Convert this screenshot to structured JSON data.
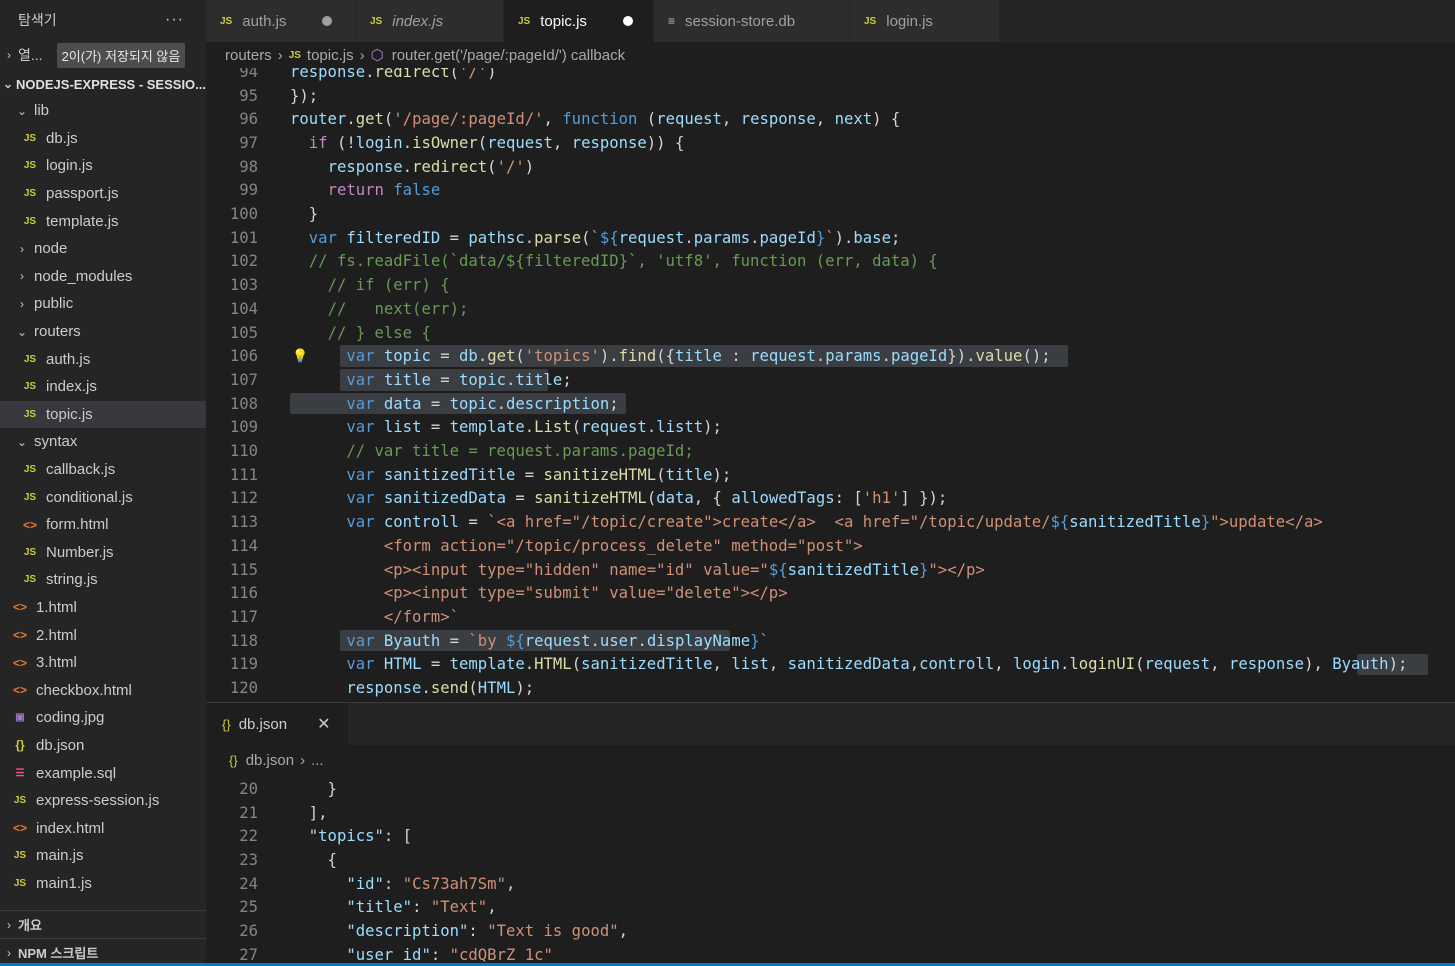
{
  "sidebar": {
    "title": "탐색기",
    "more": "···",
    "open_editors": {
      "label": "열...",
      "badge": "2이(가) 저장되지 않음"
    },
    "project": "NODEJS-EXPRESS - SESSIO...",
    "tree": [
      {
        "label": "lib",
        "type": "folder-open",
        "indent": 0
      },
      {
        "label": "db.js",
        "type": "js",
        "indent": 1
      },
      {
        "label": "login.js",
        "type": "js",
        "indent": 1
      },
      {
        "label": "passport.js",
        "type": "js",
        "indent": 1
      },
      {
        "label": "template.js",
        "type": "js",
        "indent": 1
      },
      {
        "label": "node",
        "type": "folder",
        "indent": 0
      },
      {
        "label": "node_modules",
        "type": "folder",
        "indent": 0
      },
      {
        "label": "public",
        "type": "folder",
        "indent": 0
      },
      {
        "label": "routers",
        "type": "folder-open",
        "indent": 0
      },
      {
        "label": "auth.js",
        "type": "js",
        "indent": 1
      },
      {
        "label": "index.js",
        "type": "js",
        "indent": 1
      },
      {
        "label": "topic.js",
        "type": "js",
        "indent": 1,
        "selected": true
      },
      {
        "label": "syntax",
        "type": "folder-open",
        "indent": 0
      },
      {
        "label": "callback.js",
        "type": "js",
        "indent": 1
      },
      {
        "label": "conditional.js",
        "type": "js",
        "indent": 1
      },
      {
        "label": "form.html",
        "type": "html",
        "indent": 1
      },
      {
        "label": "Number.js",
        "type": "js",
        "indent": 1
      },
      {
        "label": "string.js",
        "type": "js",
        "indent": 1
      },
      {
        "label": "1.html",
        "type": "html",
        "indent": 0
      },
      {
        "label": "2.html",
        "type": "html",
        "indent": 0
      },
      {
        "label": "3.html",
        "type": "html",
        "indent": 0
      },
      {
        "label": "checkbox.html",
        "type": "html",
        "indent": 0
      },
      {
        "label": "coding.jpg",
        "type": "img",
        "indent": 0
      },
      {
        "label": "db.json",
        "type": "json",
        "indent": 0
      },
      {
        "label": "example.sql",
        "type": "sql",
        "indent": 0
      },
      {
        "label": "express-session.js",
        "type": "js",
        "indent": 0
      },
      {
        "label": "index.html",
        "type": "html",
        "indent": 0
      },
      {
        "label": "main.js",
        "type": "js",
        "indent": 0
      },
      {
        "label": "main1.js",
        "type": "js",
        "indent": 0
      }
    ],
    "outline": "개요",
    "npm": "NPM 스크립트"
  },
  "tabs": [
    {
      "label": "auth.js",
      "icon": "js",
      "dirty": true,
      "italic": false,
      "active": false
    },
    {
      "label": "index.js",
      "icon": "js",
      "dirty": false,
      "italic": true,
      "active": false
    },
    {
      "label": "topic.js",
      "icon": "js",
      "dirty": true,
      "italic": false,
      "active": true
    },
    {
      "label": "session-store.db",
      "icon": "db",
      "dirty": false,
      "italic": false,
      "active": false
    },
    {
      "label": "login.js",
      "icon": "js",
      "dirty": false,
      "italic": false,
      "active": false
    }
  ],
  "breadcrumb": {
    "folder": "routers",
    "file": "topic.js",
    "symbol": "router.get('/page/:pageId/') callback"
  },
  "editor": {
    "lines": [
      {
        "n": "94",
        "html": "<span class='v'>response</span>.<span class='f'>redirect</span>(<span class='s'>'/'</span>)"
      },
      {
        "n": "95",
        "html": "});"
      },
      {
        "n": "96",
        "html": "<span class='v'>router</span>.<span class='f'>get</span>(<span class='s'>'/page/:pageId/'</span>, <span class='k'>function</span> (<span class='v'>request</span>, <span class='v'>response</span>, <span class='v'>next</span>) {"
      },
      {
        "n": "97",
        "html": "  <span class='kc'>if</span> (!<span class='v'>login</span>.<span class='f'>isOwner</span>(<span class='v'>request</span>, <span class='v'>response</span>)) {"
      },
      {
        "n": "98",
        "html": "    <span class='v'>response</span>.<span class='f'>redirect</span>(<span class='s'>'/'</span>)"
      },
      {
        "n": "99",
        "html": "    <span class='kc'>return</span> <span class='k'>false</span>"
      },
      {
        "n": "100",
        "html": "  }"
      },
      {
        "n": "101",
        "html": "  <span class='k'>var</span> <span class='v'>filteredID</span> = <span class='v'>pathsc</span>.<span class='f'>parse</span>(<span class='s'>`</span><span class='k'>${</span><span class='v'>request</span>.<span class='v'>params</span>.<span class='v'>pageId</span><span class='k'>}</span><span class='s'>`</span>).<span class='v'>base</span>;"
      },
      {
        "n": "102",
        "html": "  <span class='c'>// fs.readFile(`data/${filteredID}`, 'utf8', function (err, data) {</span>"
      },
      {
        "n": "103",
        "html": "    <span class='c'>// if (err) {</span>"
      },
      {
        "n": "104",
        "html": "    <span class='c'>//   next(err);</span>"
      },
      {
        "n": "105",
        "html": "    <span class='c'>// } else {</span>"
      },
      {
        "n": "106",
        "html": "      <span class='k'>var</span> <span class='v'>topic</span> = <span class='v'>db</span>.<span class='f'>get</span>(<span class='s'>'topics'</span>).<span class='f'>find</span>({<span class='v'>title</span> : <span class='v'>request</span>.<span class='v'>params</span>.<span class='v'>pageId</span>}).<span class='f'>value</span>();",
        "hl": [
          50,
          778
        ],
        "bulb": true
      },
      {
        "n": "107",
        "html": "      <span class='k'>var</span> <span class='v'>title</span> = <span class='v'>topic</span>.<span class='v'>title</span>;",
        "hl": [
          50,
          258
        ]
      },
      {
        "n": "108",
        "html": "      <span class='k'>var</span> <span class='v'>data</span> = <span class='v'>topic</span>.<span class='v'>description</span>;",
        "hl": [
          0,
          336
        ]
      },
      {
        "n": "109",
        "html": "      <span class='k'>var</span> <span class='v'>list</span> = <span class='v'>template</span>.<span class='f'>List</span>(<span class='v'>request</span>.<span class='v'>listt</span>);"
      },
      {
        "n": "110",
        "html": "      <span class='c'>// var title = request.params.pageId;</span>"
      },
      {
        "n": "111",
        "html": "      <span class='k'>var</span> <span class='v'>sanitizedTitle</span> = <span class='f'>sanitizeHTML</span>(<span class='v'>title</span>);"
      },
      {
        "n": "112",
        "html": "      <span class='k'>var</span> <span class='v'>sanitizedData</span> = <span class='f'>sanitizeHTML</span>(<span class='v'>data</span>, { <span class='v'>allowedTags</span>: [<span class='s'>'h1'</span>] });"
      },
      {
        "n": "113",
        "html": "      <span class='k'>var</span> <span class='v'>controll</span> = <span class='s'>`&lt;a href=\"/topic/create\"&gt;create&lt;/a&gt;  &lt;a href=\"/topic/update/</span><span class='k'>${</span><span class='v'>sanitizedTitle</span><span class='k'>}</span><span class='s'>\"&gt;update&lt;/a&gt;</span>"
      },
      {
        "n": "114",
        "html": "<span class='s'>          &lt;form action=\"/topic/process_delete\" method=\"post\"&gt;</span>"
      },
      {
        "n": "115",
        "html": "<span class='s'>          &lt;p&gt;&lt;input type=\"hidden\" name=\"id\" value=\"</span><span class='k'>${</span><span class='v'>sanitizedTitle</span><span class='k'>}</span><span class='s'>\"&gt;&lt;/p&gt;</span>"
      },
      {
        "n": "116",
        "html": "<span class='s'>          &lt;p&gt;&lt;input type=\"submit\" value=\"delete\"&gt;&lt;/p&gt;</span>"
      },
      {
        "n": "117",
        "html": "<span class='s'>          &lt;/form&gt;`</span>"
      },
      {
        "n": "118",
        "html": "      <span class='k'>var</span> <span class='v'>Byauth</span> = <span class='s'>`by </span><span class='k'>${</span><span class='v'>request</span>.<span class='v'>user</span>.<span class='v'>displayName</span><span class='k'>}</span><span class='s'>`</span>",
        "hl": [
          50,
          440
        ]
      },
      {
        "n": "119",
        "html": "      <span class='k'>var</span> <span class='v'>HTML</span> = <span class='v'>template</span>.<span class='f'>HTML</span>(<span class='v'>sanitizedTitle</span>, <span class='v'>list</span>, <span class='v'>sanitizedData</span>,<span class='v'>controll</span>, <span class='v'>login</span>.<span class='f'>loginUI</span>(<span class='v'>request</span>, <span class='v'>response</span>), <span class='v'>Byauth</span>);",
        "hl": [
          1067,
          1138
        ]
      },
      {
        "n": "120",
        "html": "      <span class='v'>response</span>.<span class='f'>send</span>(<span class='v'>HTML</span>);"
      }
    ]
  },
  "panel": {
    "tab_label": "db.json",
    "close": "✕",
    "breadcrumb_file": "db.json",
    "breadcrumb_rest": "...",
    "lines": [
      {
        "n": "20",
        "html": "    }"
      },
      {
        "n": "21",
        "html": "  ],"
      },
      {
        "n": "22",
        "html": "  <span class='v'>\"topics\"</span>: ["
      },
      {
        "n": "23",
        "html": "    {"
      },
      {
        "n": "24",
        "html": "      <span class='v'>\"id\"</span>: <span class='s'>\"Cs73ah7Sm\"</span>,"
      },
      {
        "n": "25",
        "html": "      <span class='v'>\"title\"</span>: <span class='s'>\"Text\"</span>,"
      },
      {
        "n": "26",
        "html": "      <span class='v'>\"description\"</span>: <span class='s'>\"Text is good\"</span>,"
      },
      {
        "n": "27",
        "html": "      <span class='v'>\"user_id\"</span>: <span class='s'>\"cdQBrZ_1c\"</span>"
      }
    ]
  }
}
